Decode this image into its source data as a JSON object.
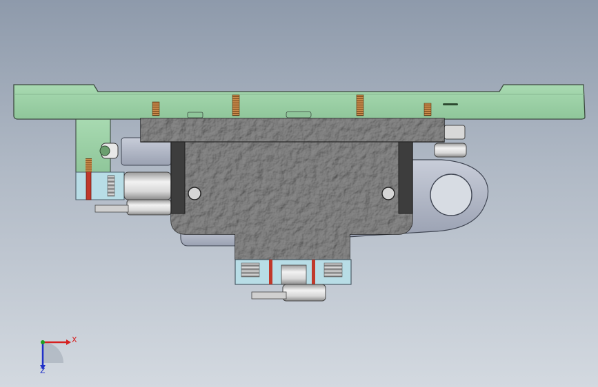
{
  "viewport": {
    "colors": {
      "plate": "#9fd4a8",
      "plate_edge": "#3c4a40",
      "housing": "#6f6f6f",
      "housing_dark": "#3d3d3d",
      "bracket": "#b9bfce",
      "clamp": "#b8dde6",
      "spring": "#b5773f",
      "rod": "#c0392b"
    }
  },
  "triad": {
    "x_label": "X",
    "z_label": "Z",
    "x_color": "#d62020",
    "y_color": "#20a020",
    "z_color": "#2030c8"
  }
}
